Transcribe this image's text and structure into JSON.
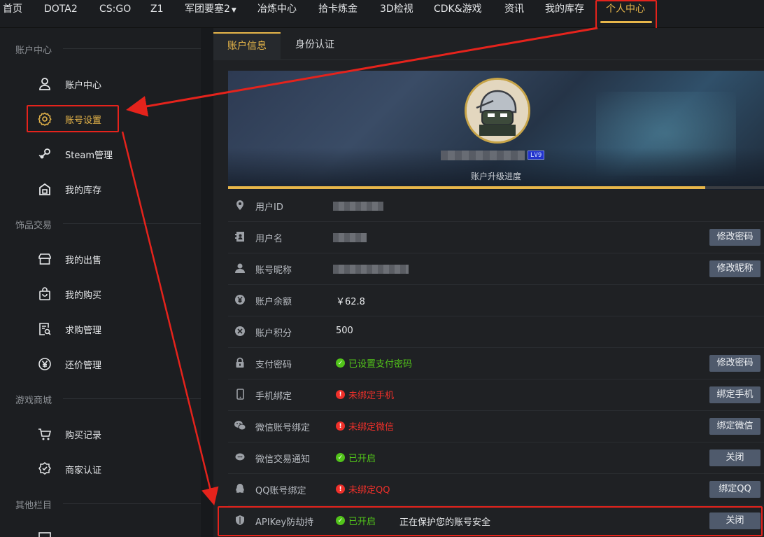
{
  "nav": {
    "items": [
      "首页",
      "DOTA2",
      "CS:GO",
      "Z1",
      "军团要塞2",
      "冶炼中心",
      "拾卡炼金",
      "3D检视",
      "CDK&游戏",
      "资讯",
      "我的库存",
      "个人中心"
    ],
    "active_index": 11
  },
  "sidebar": {
    "sections": [
      {
        "title": "账户中心",
        "items": [
          {
            "label": "账户中心",
            "icon": "user-icon"
          },
          {
            "label": "账号设置",
            "icon": "gear-icon"
          },
          {
            "label": "Steam管理",
            "icon": "steam-icon"
          },
          {
            "label": "我的库存",
            "icon": "inventory-icon"
          }
        ]
      },
      {
        "title": "饰品交易",
        "items": [
          {
            "label": "我的出售",
            "icon": "store-icon"
          },
          {
            "label": "我的购买",
            "icon": "bag-icon"
          },
          {
            "label": "求购管理",
            "icon": "search-doc-icon"
          },
          {
            "label": "还价管理",
            "icon": "yen-icon"
          }
        ]
      },
      {
        "title": "游戏商城",
        "items": [
          {
            "label": "购买记录",
            "icon": "cart-icon"
          },
          {
            "label": "商家认证",
            "icon": "badge-icon"
          }
        ]
      },
      {
        "title": "其他栏目",
        "items": []
      }
    ],
    "active_item": "账号设置"
  },
  "tabs": [
    "账户信息",
    "身份认证"
  ],
  "profile": {
    "level_badge": "LV9",
    "upgrade_label": "账户升级进度",
    "upgrade_progress": 0.89
  },
  "rows": [
    {
      "label": "用户ID",
      "icon": "location-icon",
      "value": "",
      "masked": true
    },
    {
      "label": "用户名",
      "icon": "contact-card-icon",
      "value": "",
      "masked": true,
      "button": "修改密码"
    },
    {
      "label": "账号昵称",
      "icon": "person-icon",
      "value": "",
      "masked": true,
      "button": "修改昵称"
    },
    {
      "label": "账户余额",
      "icon": "yen-circle-icon",
      "value": "￥62.8"
    },
    {
      "label": "账户积分",
      "icon": "points-icon",
      "value": "500"
    },
    {
      "label": "支付密码",
      "icon": "lock-icon",
      "status": "已设置支付密码",
      "status_type": "ok",
      "button": "修改密码"
    },
    {
      "label": "手机绑定",
      "icon": "phone-icon",
      "status": "未绑定手机",
      "status_type": "bad",
      "button": "绑定手机"
    },
    {
      "label": "微信账号绑定",
      "icon": "wechat-icon",
      "status": "未绑定微信",
      "status_type": "bad",
      "button": "绑定微信"
    },
    {
      "label": "微信交易通知",
      "icon": "chat-bubble-icon",
      "status": "已开启",
      "status_type": "ok",
      "button": "关闭"
    },
    {
      "label": "QQ账号绑定",
      "icon": "qq-icon",
      "status": "未绑定QQ",
      "status_type": "bad",
      "button": "绑定QQ"
    },
    {
      "label": "APIKey防劫持",
      "icon": "shield-icon",
      "status": "已开启",
      "status_type": "ok",
      "extra": "正在保护您的账号安全",
      "button": "关闭"
    }
  ],
  "colors": {
    "accent": "#e7b64a",
    "annotation_red": "#e5231c",
    "ok": "#52c41a",
    "bad": "#f0302a",
    "button": "#4f5a6c"
  }
}
